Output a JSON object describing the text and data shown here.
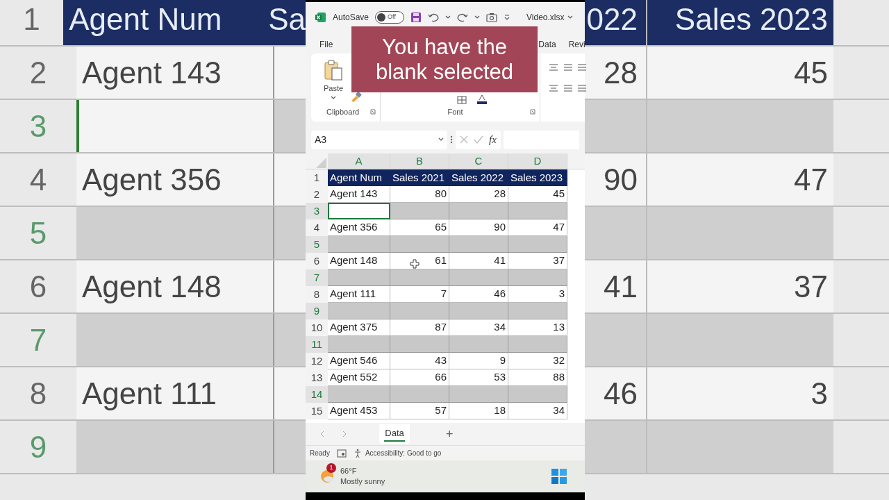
{
  "backdrop": {
    "rows": [
      {
        "number": "1",
        "kind": "header",
        "left_cells": [
          "Agent Num",
          "Sa"
        ],
        "right_cells": [
          "022",
          "Sales 2023"
        ]
      },
      {
        "number": "2",
        "kind": "data",
        "left_cells": [
          "Agent 143"
        ],
        "right_cells": [
          "28",
          "45"
        ]
      },
      {
        "number": "3",
        "kind": "blank",
        "active": true
      },
      {
        "number": "4",
        "kind": "data",
        "left_cells": [
          "Agent 356"
        ],
        "right_cells": [
          "90",
          "47"
        ]
      },
      {
        "number": "5",
        "kind": "blank",
        "active": false
      },
      {
        "number": "6",
        "kind": "data",
        "left_cells": [
          "Agent 148"
        ],
        "right_cells": [
          "41",
          "37"
        ]
      },
      {
        "number": "7",
        "kind": "blank",
        "active": false
      },
      {
        "number": "8",
        "kind": "data",
        "left_cells": [
          "Agent 111"
        ],
        "right_cells": [
          "46",
          "3"
        ]
      },
      {
        "number": "9",
        "kind": "blank",
        "active": false
      }
    ]
  },
  "window": {
    "autosave_label": "AutoSave",
    "autosave": {
      "on": false,
      "label": "Off"
    },
    "file_name": "Video.xlsx"
  },
  "ribbon_tabs": [
    "File",
    "Data",
    "Revi"
  ],
  "ribbon": {
    "paste_label": "Paste",
    "clipboard_label": "Clipboard",
    "font_label": "Font"
  },
  "caption": "You have the blank selected",
  "formula_bar": {
    "name_box": "A3",
    "fx": "fx"
  },
  "sheet": {
    "columns": [
      {
        "label": "A",
        "selected": true
      },
      {
        "label": "B",
        "selected": true
      },
      {
        "label": "C",
        "selected": true
      },
      {
        "label": "D",
        "selected": true
      }
    ],
    "rows": [
      {
        "number": "1",
        "kind": "header",
        "selected": false,
        "cells": [
          "Agent Num",
          "Sales 2021",
          "Sales 2022",
          "Sales 2023"
        ]
      },
      {
        "number": "2",
        "kind": "data",
        "selected": false,
        "cells": [
          "Agent 143",
          "80",
          "28",
          "45"
        ]
      },
      {
        "number": "3",
        "kind": "blank",
        "selected": true,
        "active": true
      },
      {
        "number": "4",
        "kind": "data",
        "selected": false,
        "cells": [
          "Agent 356",
          "65",
          "90",
          "47"
        ]
      },
      {
        "number": "5",
        "kind": "blank",
        "selected": true,
        "active": false
      },
      {
        "number": "6",
        "kind": "data",
        "selected": false,
        "cells": [
          "Agent 148",
          "61",
          "41",
          "37"
        ]
      },
      {
        "number": "7",
        "kind": "blank",
        "selected": true,
        "active": false
      },
      {
        "number": "8",
        "kind": "data",
        "selected": false,
        "cells": [
          "Agent 111",
          "7",
          "46",
          "3"
        ]
      },
      {
        "number": "9",
        "kind": "blank",
        "selected": true,
        "active": false
      },
      {
        "number": "10",
        "kind": "data",
        "selected": false,
        "cells": [
          "Agent 375",
          "87",
          "34",
          "13"
        ]
      },
      {
        "number": "11",
        "kind": "blank",
        "selected": true,
        "active": false
      },
      {
        "number": "12",
        "kind": "data",
        "selected": false,
        "cells": [
          "Agent 546",
          "43",
          "9",
          "32"
        ]
      },
      {
        "number": "13",
        "kind": "data",
        "selected": false,
        "cells": [
          "Agent 552",
          "66",
          "53",
          "88"
        ]
      },
      {
        "number": "14",
        "kind": "blank",
        "selected": true,
        "active": false
      },
      {
        "number": "15",
        "kind": "data",
        "selected": false,
        "cells": [
          "Agent 453",
          "57",
          "18",
          "34"
        ]
      }
    ]
  },
  "sheet_tabs": [
    {
      "label": "Data",
      "selected": true
    }
  ],
  "add_sheet": "+",
  "status_bar": {
    "ready": "Ready",
    "accessibility": "Accessibility: Good to go"
  },
  "taskbar": {
    "badge": "1",
    "temperature": "66°F",
    "weather": "Mostly sunny"
  }
}
